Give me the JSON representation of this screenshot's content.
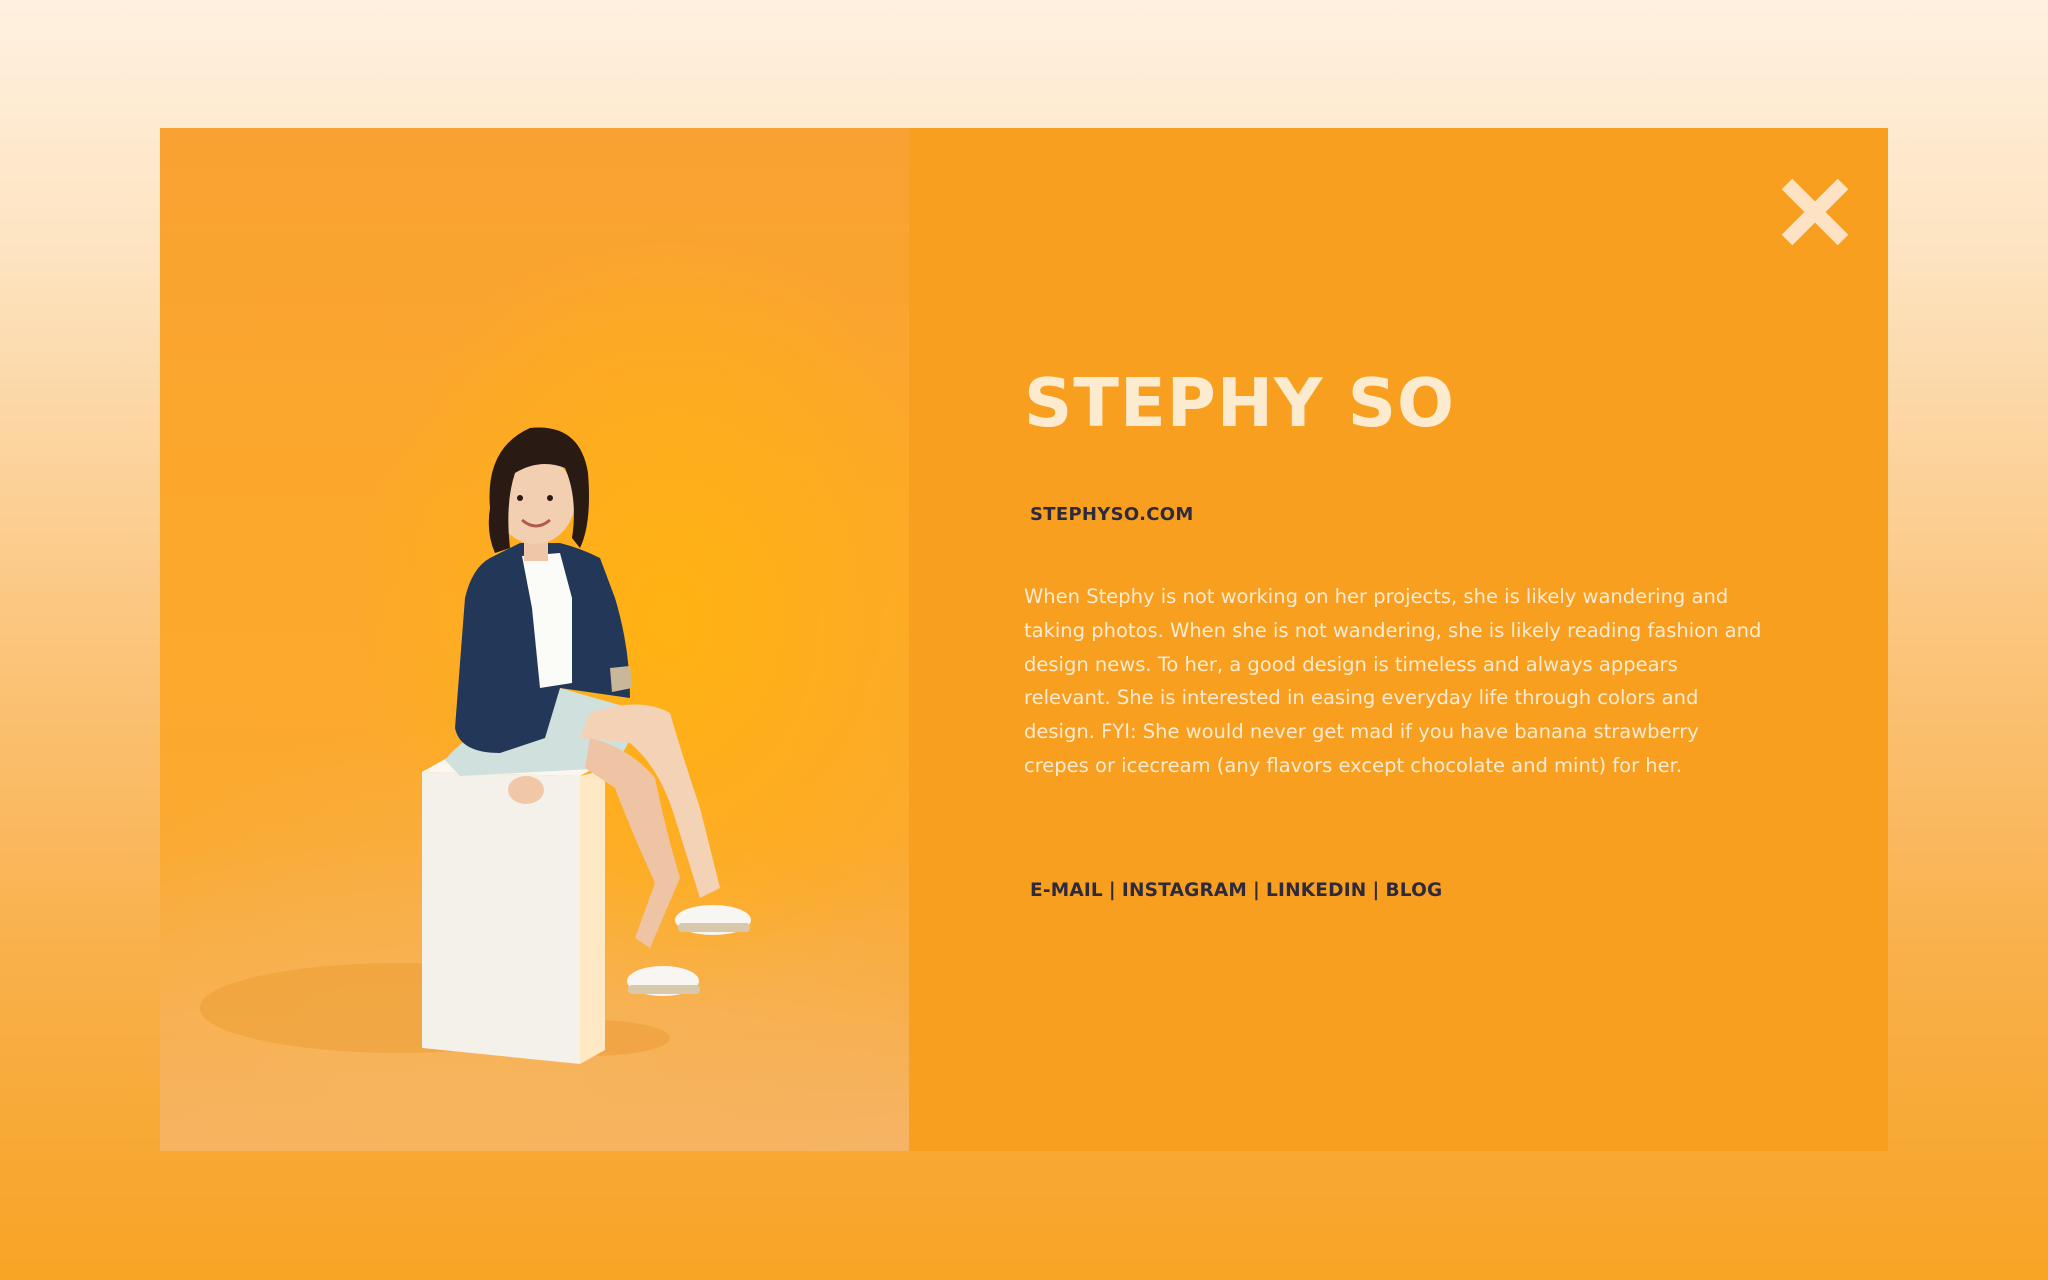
{
  "profile": {
    "name": "STEPHY SO",
    "website": "STEPHYSO.COM",
    "bio": "When Stephy is not working on her projects, she is likely wandering and taking photos. When she is not wandering, she is likely reading fashion and design news. To her, a good design is timeless and always appears relevant. She is interested in easing everyday life through colors and design. FYI: She would never get mad if you have banana strawberry crepes or icecream (any flavors except chocolate and mint) for her."
  },
  "links": {
    "items": [
      "E-MAIL",
      "INSTAGRAM",
      "LINKEDIN",
      "BLOG"
    ],
    "separator": "|"
  },
  "controls": {
    "close_icon": "close-x-icon"
  },
  "colors": {
    "modal_background": "#f89f1f",
    "name_text": "#fdebd0",
    "body_text": "#fdebd3",
    "link_text": "#2d2a3c"
  }
}
